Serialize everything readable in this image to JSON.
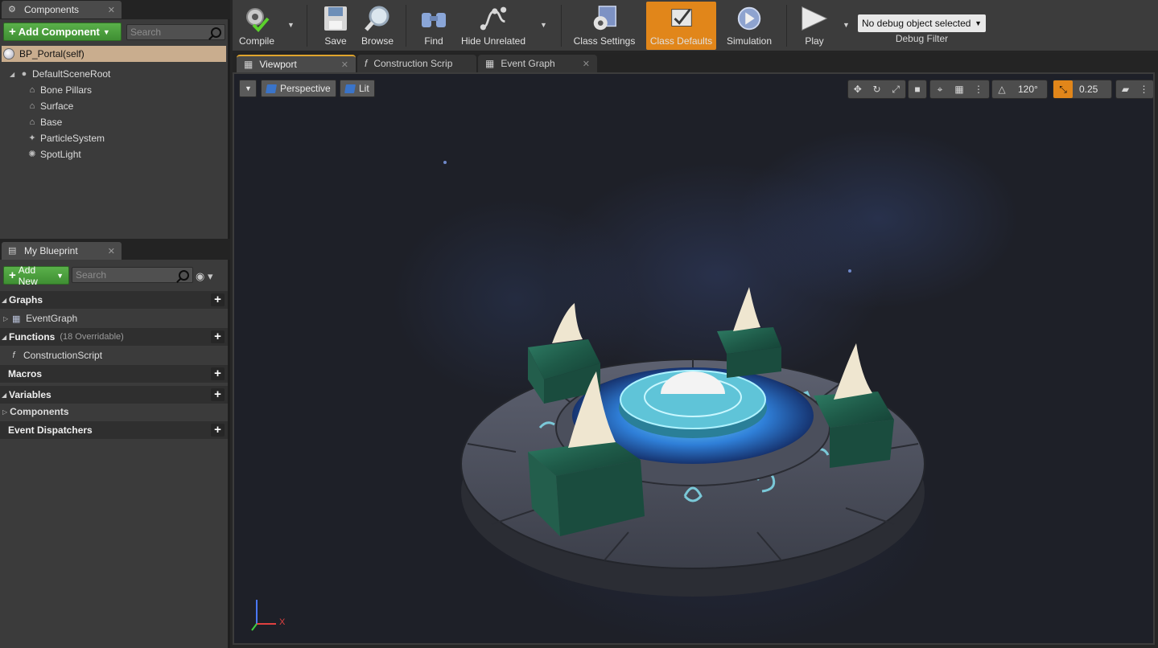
{
  "components_panel": {
    "tab_label": "Components",
    "add_button": "Add Component",
    "search_placeholder": "Search",
    "self_item": "BP_Portal(self)",
    "tree": [
      {
        "label": "DefaultSceneRoot",
        "icon": "scene-root-icon"
      },
      {
        "label": "Bone Pillars",
        "icon": "mesh-icon"
      },
      {
        "label": "Surface",
        "icon": "mesh-icon"
      },
      {
        "label": "Base",
        "icon": "mesh-icon"
      },
      {
        "label": "ParticleSystem",
        "icon": "particle-icon"
      },
      {
        "label": "SpotLight",
        "icon": "spotlight-icon"
      }
    ]
  },
  "my_blueprint": {
    "tab_label": "My Blueprint",
    "add_button": "Add New",
    "search_placeholder": "Search",
    "sections": {
      "graphs": "Graphs",
      "event_graph": "EventGraph",
      "functions": "Functions",
      "functions_sub": "(18 Overridable)",
      "construction_script": "ConstructionScript",
      "macros": "Macros",
      "variables": "Variables",
      "components": "Components",
      "event_dispatchers": "Event Dispatchers"
    }
  },
  "toolbar": {
    "compile": "Compile",
    "save": "Save",
    "browse": "Browse",
    "find": "Find",
    "hide_unrelated": "Hide Unrelated",
    "class_settings": "Class Settings",
    "class_defaults": "Class Defaults",
    "simulation": "Simulation",
    "play": "Play",
    "debug_object": "No debug object selected",
    "debug_filter": "Debug Filter",
    "accent_color": "#e1861a"
  },
  "doc_tabs": [
    {
      "label": "Viewport",
      "active": true
    },
    {
      "label": "Construction Scrip",
      "active": false
    },
    {
      "label": "Event Graph",
      "active": false
    }
  ],
  "viewport": {
    "view_mode": "Perspective",
    "lighting": "Lit",
    "fov": "120°",
    "snap_value": "0.25",
    "axis_x": "X"
  }
}
